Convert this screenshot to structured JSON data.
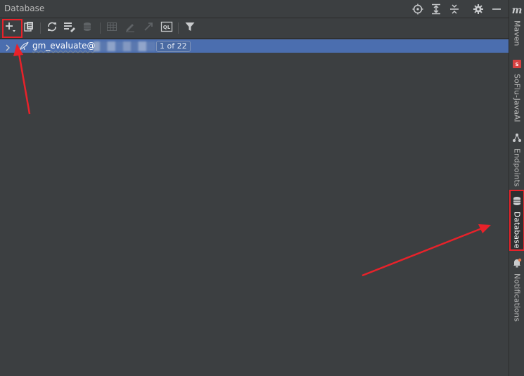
{
  "header": {
    "title": "Database",
    "actions": [
      {
        "icon": "target-icon"
      },
      {
        "icon": "expand-all-icon"
      },
      {
        "icon": "collapse-all-icon"
      },
      {
        "icon": "gear-icon"
      },
      {
        "icon": "minimize-icon"
      }
    ]
  },
  "toolbar": {
    "items": [
      {
        "icon": "plus-icon",
        "enabled": true
      },
      {
        "icon": "copy-icon",
        "enabled": true
      },
      {
        "icon": "refresh-icon",
        "enabled": true
      },
      {
        "icon": "data-source-properties-icon",
        "enabled": true
      },
      {
        "icon": "database-stack-icon",
        "enabled": false
      },
      {
        "icon": "table-icon",
        "enabled": false
      },
      {
        "icon": "edit-icon",
        "enabled": false
      },
      {
        "icon": "jump-icon",
        "enabled": false
      },
      {
        "icon": "query-console-icon",
        "enabled": true,
        "label": "QL"
      },
      {
        "icon": "filter-icon",
        "enabled": true
      }
    ]
  },
  "tree": {
    "rows": [
      {
        "name": "gm_evaluate@",
        "host_redacted": true,
        "badge": "1 of 22",
        "selected": true
      }
    ]
  },
  "right_stripe": [
    {
      "label": "Maven",
      "icon": "maven-icon",
      "active": false
    },
    {
      "label": "SoFlu-JavaAI",
      "icon": "soflu-icon",
      "active": false
    },
    {
      "label": "Endpoints",
      "icon": "endpoints-icon",
      "active": false
    },
    {
      "label": "Database",
      "icon": "database-icon",
      "active": true
    },
    {
      "label": "Notifications",
      "icon": "bell-icon",
      "active": false
    }
  ],
  "colors": {
    "panel_bg": "#3c3f41",
    "selection": "#4b6eaf",
    "annotation_red": "#e8222a"
  }
}
